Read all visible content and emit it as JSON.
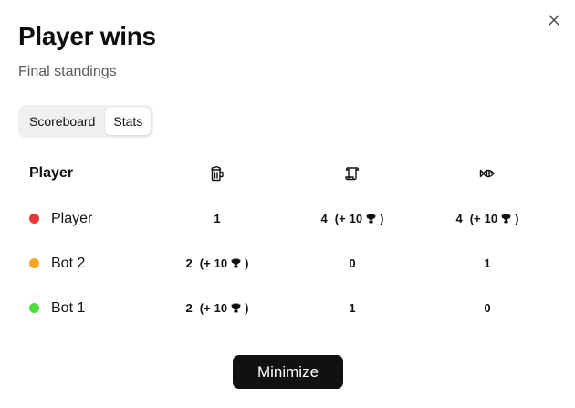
{
  "dialog": {
    "title": "Player wins",
    "subtitle": "Final standings",
    "close_icon": "close-icon"
  },
  "tabs": [
    {
      "label": "Scoreboard",
      "active": false
    },
    {
      "label": "Stats",
      "active": true
    }
  ],
  "table": {
    "header": {
      "player_label": "Player",
      "columns": [
        {
          "icon": "mug-icon"
        },
        {
          "icon": "scroll-icon"
        },
        {
          "icon": "fish-icon"
        }
      ]
    },
    "rows": [
      {
        "name": "Player",
        "color": "#e53935",
        "cells": [
          {
            "value": "1",
            "bonus_open": "",
            "bonus_value": "",
            "bonus_close": ""
          },
          {
            "value": "4",
            "bonus_open": "(+",
            "bonus_value": "10",
            "bonus_close": ")"
          },
          {
            "value": "4",
            "bonus_open": "(+",
            "bonus_value": "10",
            "bonus_close": ")"
          }
        ]
      },
      {
        "name": "Bot 2",
        "color": "#f5a623",
        "cells": [
          {
            "value": "2",
            "bonus_open": "(+",
            "bonus_value": "10",
            "bonus_close": ")"
          },
          {
            "value": "0",
            "bonus_open": "",
            "bonus_value": "",
            "bonus_close": ""
          },
          {
            "value": "1",
            "bonus_open": "",
            "bonus_value": "",
            "bonus_close": ""
          }
        ]
      },
      {
        "name": "Bot 1",
        "color": "#4cde3a",
        "cells": [
          {
            "value": "2",
            "bonus_open": "(+",
            "bonus_value": "10",
            "bonus_close": ")"
          },
          {
            "value": "1",
            "bonus_open": "",
            "bonus_value": "",
            "bonus_close": ""
          },
          {
            "value": "0",
            "bonus_open": "",
            "bonus_value": "",
            "bonus_close": ""
          }
        ]
      }
    ]
  },
  "footer": {
    "minimize_label": "Minimize"
  },
  "colors": {
    "button_bg": "#111111",
    "tabs_bg": "#f0f0f0",
    "subtitle": "#5b5b5b"
  }
}
